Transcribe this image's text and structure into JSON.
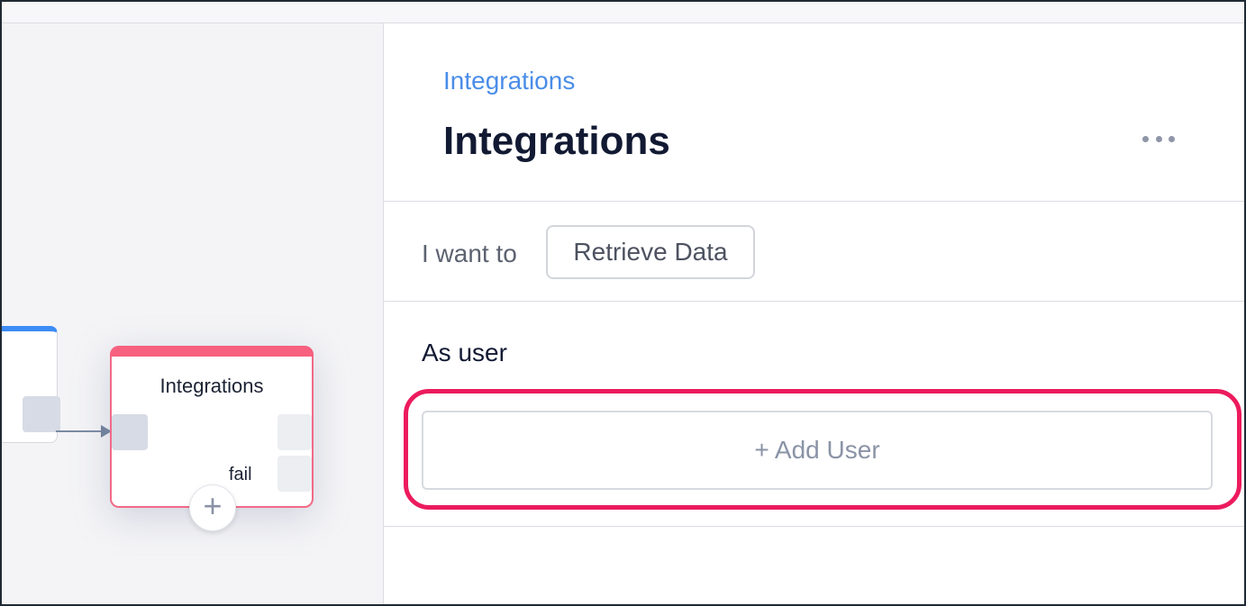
{
  "canvas": {
    "node": {
      "title": "Integrations",
      "fail_label": "fail",
      "header_color": "#f7617f",
      "add_icon": "plus-icon",
      "add_glyph": "+"
    },
    "left_node_header_color": "#3d8bf5"
  },
  "panel": {
    "breadcrumb": "Integrations",
    "title": "Integrations",
    "more_icon": "more-horizontal-icon",
    "intent_label": "I want to",
    "intent_value": "Retrieve Data",
    "as_user_label": "As user",
    "add_user_label": "+ Add User",
    "highlight_color": "#ec1b5e",
    "accent_color": "#4a8de8"
  }
}
